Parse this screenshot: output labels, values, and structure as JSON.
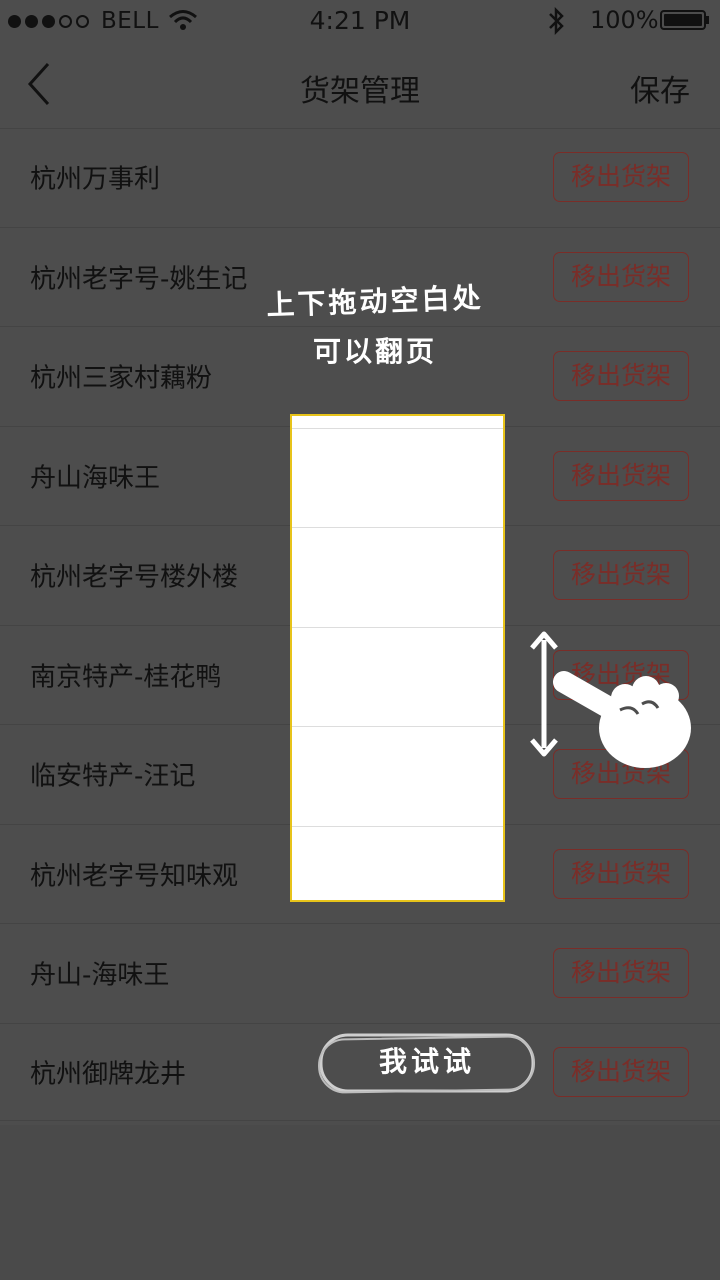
{
  "status_bar": {
    "carrier": "BELL",
    "time": "4:21 PM",
    "battery": "100%"
  },
  "nav": {
    "title": "货架管理",
    "save_label": "保存"
  },
  "shelf_items": [
    {
      "name": "杭州万事利",
      "action": "移出货架"
    },
    {
      "name": "杭州老字号-姚生记",
      "action": "移出货架"
    },
    {
      "name": "杭州三家村藕粉",
      "action": "移出货架"
    },
    {
      "name": "舟山海味王",
      "action": "移出货架"
    },
    {
      "name": "杭州老字号楼外楼",
      "action": "移出货架"
    },
    {
      "name": "南京特产-桂花鸭",
      "action": "移出货架"
    },
    {
      "name": "临安特产-汪记",
      "action": "移出货架"
    },
    {
      "name": "杭州老字号知味观",
      "action": "移出货架"
    },
    {
      "name": "舟山-海味王",
      "action": "移出货架"
    },
    {
      "name": "杭州御牌龙井",
      "action": "移出货架"
    }
  ],
  "guide": {
    "hint_line1": "上下拖动空白处",
    "hint_line2": "可以翻页",
    "try_label": "我试试"
  },
  "colors": {
    "overlay_background": "#4d4d4d",
    "remove_button": "#7a2d28",
    "highlight_border": "#e7c31a"
  },
  "icons": [
    "back-chevron-icon",
    "wifi-icon",
    "bluetooth-icon",
    "battery-icon",
    "drag-arrow-icon",
    "hand-pointer-icon"
  ]
}
